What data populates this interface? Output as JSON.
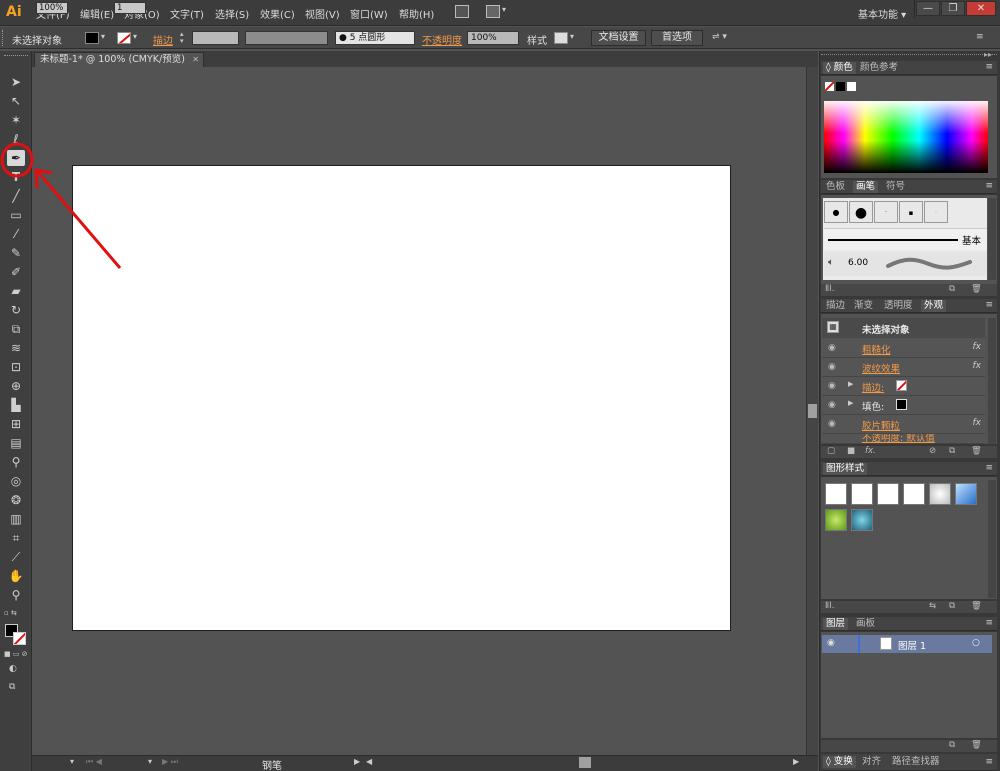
{
  "app": {
    "logo": "Ai",
    "workspace": "基本功能"
  },
  "menus": [
    "文件(F)",
    "编辑(E)",
    "对象(O)",
    "文字(T)",
    "选择(S)",
    "效果(C)",
    "视图(V)",
    "窗口(W)",
    "帮助(H)"
  ],
  "window_buttons": [
    "—",
    "❐",
    "✕"
  ],
  "control_bar": {
    "selection_label": "未选择对象",
    "stroke_link": "描边",
    "brush_profile": "5 点圆形",
    "opacity_link": "不透明度",
    "opacity_value": "100%",
    "style_label": "样式",
    "doc_setup_button": "文档设置",
    "preferences_button": "首选项"
  },
  "document": {
    "tab_title": "未标题-1* @ 100% (CMYK/预览)",
    "tab_close": "✕"
  },
  "status_bar": {
    "zoom": "100%",
    "artboard": "1",
    "current_tool": "钢笔"
  },
  "panels": {
    "color": {
      "tabs": [
        "颜色",
        "颜色参考"
      ]
    },
    "brushes": {
      "tabs": [
        "色板",
        "画笔",
        "符号"
      ],
      "basic_label": "基本",
      "size_value": "6.00"
    },
    "appearance": {
      "tabs": [
        "描边",
        "渐变",
        "透明度",
        "外观"
      ],
      "header": "未选择对象",
      "rows": [
        {
          "label": "粗糙化",
          "fx": "fx"
        },
        {
          "label": "波纹效果",
          "fx": "fx"
        },
        {
          "label": "描边:",
          "fx": ""
        },
        {
          "label": "填色:",
          "fx": ""
        },
        {
          "label": "胶片颗粒",
          "fx": "fx"
        },
        {
          "label": "不透明度: 默认值",
          "fx": ""
        }
      ]
    },
    "graphic_styles": {
      "tabs": [
        "图形样式"
      ]
    },
    "layers": {
      "tabs": [
        "图层",
        "画板"
      ],
      "layer_name": "图层 1"
    },
    "bottom": {
      "tabs": [
        "变换",
        "对齐",
        "路径查找器"
      ]
    }
  },
  "colors": {
    "accent": "#f09a4a",
    "highlight_circle": "#e01010",
    "annotation_arrow": "#e01010"
  }
}
